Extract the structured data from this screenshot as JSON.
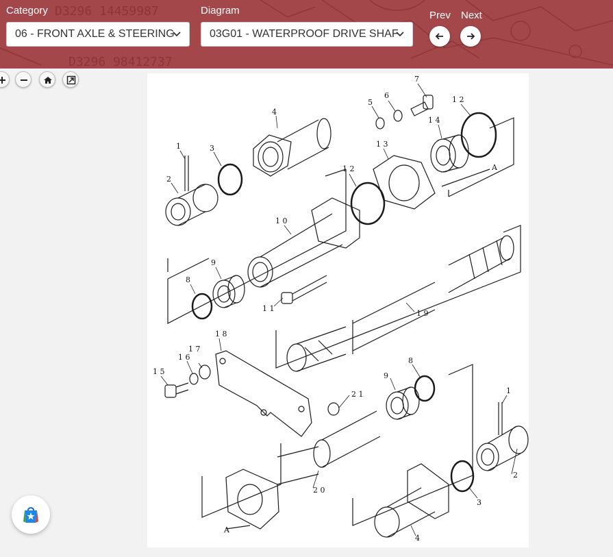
{
  "header": {
    "category_label": "Category",
    "category_value": "06 - FRONT AXLE & STEERING",
    "diagram_label": "Diagram",
    "diagram_value": "03G01 - WATERPROOF DRIVE SHAF",
    "prev_label": "Prev",
    "next_label": "Next",
    "bg_text_1": "D3296 14459987",
    "bg_text_2": "D3296 98412737"
  },
  "toolbar": {
    "icons": [
      "zoom-in-icon",
      "zoom-out-icon",
      "home-icon",
      "fullscreen-icon"
    ]
  },
  "diagram": {
    "callouts": [
      {
        "id": "c1a",
        "text": "1"
      },
      {
        "id": "c2a",
        "text": "2"
      },
      {
        "id": "c3a",
        "text": "3"
      },
      {
        "id": "c4a",
        "text": "4"
      },
      {
        "id": "c5",
        "text": "5"
      },
      {
        "id": "c6",
        "text": "6"
      },
      {
        "id": "c7",
        "text": "7"
      },
      {
        "id": "c12a",
        "text": "1 2"
      },
      {
        "id": "c13",
        "text": "1 3"
      },
      {
        "id": "c14",
        "text": "1 4"
      },
      {
        "id": "c12b",
        "text": "1 2"
      },
      {
        "id": "c10",
        "text": "1 0"
      },
      {
        "id": "c9a",
        "text": "9"
      },
      {
        "id": "c8a",
        "text": "8"
      },
      {
        "id": "c11",
        "text": "1 1"
      },
      {
        "id": "c19",
        "text": "1 9"
      },
      {
        "id": "c18",
        "text": "1 8"
      },
      {
        "id": "c17",
        "text": "1 7"
      },
      {
        "id": "c16",
        "text": "1 6"
      },
      {
        "id": "c15",
        "text": "1 5"
      },
      {
        "id": "c21",
        "text": "2 1"
      },
      {
        "id": "c9b",
        "text": "9"
      },
      {
        "id": "c8b",
        "text": "8"
      },
      {
        "id": "c1b",
        "text": "1"
      },
      {
        "id": "c2b",
        "text": "2"
      },
      {
        "id": "c3b",
        "text": "3"
      },
      {
        "id": "c4b",
        "text": "4"
      },
      {
        "id": "c20",
        "text": "2 0"
      },
      {
        "id": "cA1",
        "text": "A"
      },
      {
        "id": "cA2",
        "text": "A"
      }
    ]
  },
  "colors": {
    "header_bg": "#a4474a",
    "header_ink": "#8a2f33",
    "line": "#1a1a1a"
  },
  "badge": {
    "icon": "shopping-bag-star-icon"
  }
}
